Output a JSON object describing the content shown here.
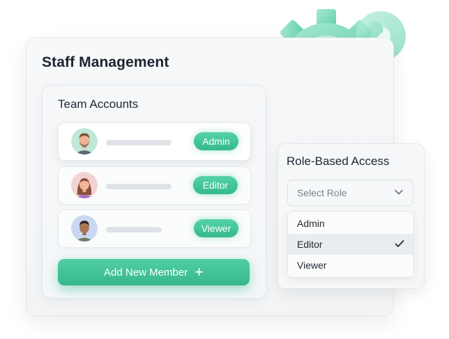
{
  "header": {
    "title": "Staff Management"
  },
  "team": {
    "title": "Team Accounts",
    "members": [
      {
        "role": "Admin"
      },
      {
        "role": "Editor"
      },
      {
        "role": "Viewer"
      }
    ],
    "add_button_label": "Add New Member"
  },
  "access": {
    "title": "Role-Based Access",
    "select_placeholder": "Select Role",
    "options": [
      "Admin",
      "Editor",
      "Viewer"
    ],
    "selected_option": "Editor"
  },
  "colors": {
    "accent": "#3fc297",
    "accent_light": "#8fe0c4"
  },
  "icons": {
    "decoration": "gear-key-icon",
    "select": "chevron-down-icon",
    "selected": "check-icon",
    "add": "plus-icon"
  }
}
